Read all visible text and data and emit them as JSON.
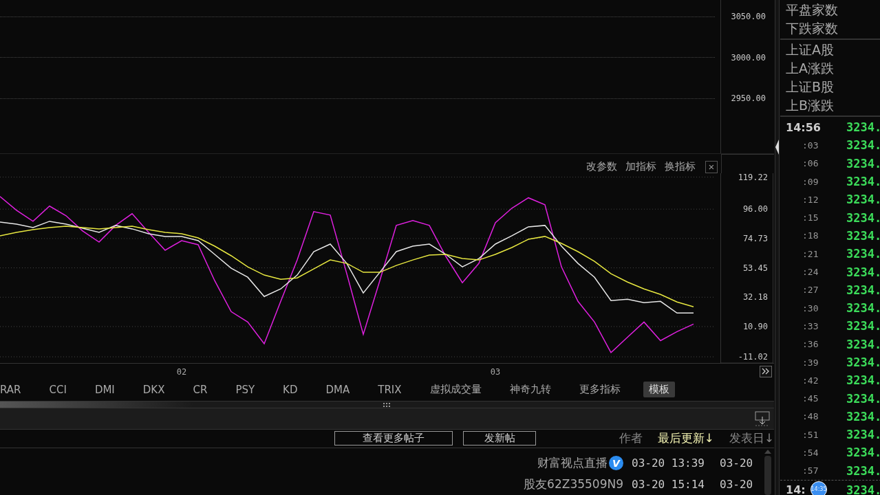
{
  "price_axis": {
    "labels": [
      "3050.00",
      "3000.00",
      "2950.00"
    ]
  },
  "indicator": {
    "buttons": [
      "改参数",
      "加指标",
      "换指标"
    ],
    "close": "×",
    "chart_data": {
      "type": "line",
      "categories": [
        null,
        null,
        null,
        null,
        null,
        null,
        null,
        null,
        null,
        null,
        null,
        "02",
        null,
        null,
        null,
        null,
        null,
        null,
        null,
        null,
        null,
        null,
        null,
        null,
        null,
        null,
        null,
        null,
        null,
        null,
        "03",
        null,
        null,
        null,
        null,
        null,
        null,
        null,
        null,
        null,
        null,
        null,
        null
      ],
      "grid": true,
      "ylim": [
        -11.02,
        119.22
      ],
      "yticks": [
        {
          "value": 119.22,
          "label": "119.22"
        },
        {
          "value": 96.0,
          "label": "96.00"
        },
        {
          "value": 74.73,
          "label": "74.73"
        },
        {
          "value": 53.45,
          "label": "53.45"
        },
        {
          "value": 32.18,
          "label": "32.18"
        },
        {
          "value": 10.9,
          "label": "10.90"
        },
        {
          "value": -11.02,
          "label": "-11.02"
        }
      ],
      "series": [
        {
          "color": "#e020e0",
          "values": [
            105.2,
            95.2,
            87.2,
            98.2,
            91.2,
            80.2,
            72.2,
            84.2,
            92.7,
            79.2,
            66.2,
            73.2,
            70.2,
            44.2,
            21.7,
            14.2,
            -1.5,
            29.2,
            59.2,
            94.2,
            91.7,
            49.2,
            5.2,
            44.2,
            84.2,
            87.7,
            84.2,
            61.7,
            42.7,
            56.7,
            86.2,
            96.7,
            104.2,
            99.2,
            54.2,
            29.2,
            14.2,
            -8.0,
            3.2,
            14.2,
            0.7,
            7.2,
            12.7
          ]
        },
        {
          "color": "#e8e8e8",
          "values": [
            86.7,
            85.2,
            82.7,
            87.2,
            85.2,
            82.2,
            79.2,
            84.2,
            81.7,
            78.2,
            76.2,
            76.2,
            73.2,
            63.2,
            53.2,
            46.7,
            32.7,
            38.2,
            48.2,
            65.2,
            70.7,
            56.7,
            35.2,
            50.2,
            65.2,
            69.2,
            70.7,
            63.2,
            54.2,
            60.2,
            70.7,
            76.7,
            83.2,
            84.2,
            69.2,
            56.7,
            46.7,
            29.7,
            30.7,
            28.2,
            29.2,
            20.7,
            20.7
          ]
        },
        {
          "color": "#e8e840",
          "values": [
            76.7,
            79.2,
            81.2,
            82.7,
            83.7,
            82.7,
            81.7,
            82.7,
            83.7,
            81.2,
            79.2,
            78.2,
            75.2,
            69.2,
            62.2,
            54.2,
            48.2,
            45.2,
            46.2,
            52.7,
            59.2,
            56.7,
            50.2,
            50.2,
            55.2,
            59.2,
            62.7,
            63.2,
            60.2,
            59.2,
            63.2,
            68.2,
            74.2,
            76.2,
            71.2,
            65.2,
            58.2,
            49.2,
            43.2,
            38.2,
            34.2,
            28.7,
            25.2
          ]
        }
      ]
    }
  },
  "indicator_tabs": [
    {
      "label": "RAR",
      "selected": false
    },
    {
      "label": "CCI",
      "selected": false
    },
    {
      "label": "DMI",
      "selected": false
    },
    {
      "label": "DKX",
      "selected": false
    },
    {
      "label": "CR",
      "selected": false
    },
    {
      "label": "PSY",
      "selected": false
    },
    {
      "label": "KD",
      "selected": false
    },
    {
      "label": "DMA",
      "selected": false
    },
    {
      "label": "TRIX",
      "selected": false
    },
    {
      "label": "虚拟成交量",
      "selected": false
    },
    {
      "label": "神奇九转",
      "selected": false
    },
    {
      "label": "更多指标",
      "selected": false
    },
    {
      "label": "模板",
      "selected": true
    }
  ],
  "forum": {
    "buttons": [
      "查看更多帖子",
      "发新帖"
    ],
    "columns": [
      {
        "label": "作者",
        "selected": false
      },
      {
        "label": "最后更新↓",
        "selected": true
      },
      {
        "label": "发表日↓",
        "selected": false
      }
    ],
    "rows": [
      {
        "author": "财富视点直播",
        "verified": true,
        "badge": "V",
        "updated": "03-20 13:39",
        "posted": "03-20"
      },
      {
        "author": "股友62Z35509N9",
        "verified": false,
        "updated": "03-20 15:14",
        "posted": "03-20"
      }
    ]
  },
  "side_panel": {
    "market_stats": [
      "平盘家数",
      "下跌家数"
    ],
    "index_stats": [
      "上证A股",
      "上A涨跌",
      "上证B股",
      "上B涨跌"
    ],
    "ticks": [
      {
        "time": "14:56",
        "price": "3234.",
        "kind": "minute",
        "marked": false
      },
      {
        "time": ":03",
        "price": "3234.",
        "kind": "second",
        "marked": false
      },
      {
        "time": ":06",
        "price": "3234.",
        "kind": "second",
        "marked": false
      },
      {
        "time": ":09",
        "price": "3234.",
        "kind": "second",
        "marked": false
      },
      {
        "time": ":12",
        "price": "3234.",
        "kind": "second",
        "marked": false
      },
      {
        "time": ":15",
        "price": "3234.",
        "kind": "second",
        "marked": false
      },
      {
        "time": ":18",
        "price": "3234.",
        "kind": "second",
        "marked": false
      },
      {
        "time": ":21",
        "price": "3234.",
        "kind": "second",
        "marked": false
      },
      {
        "time": ":24",
        "price": "3234.",
        "kind": "second",
        "marked": false
      },
      {
        "time": ":27",
        "price": "3234.",
        "kind": "second",
        "marked": false
      },
      {
        "time": ":30",
        "price": "3234.",
        "kind": "second",
        "marked": false
      },
      {
        "time": ":33",
        "price": "3234.",
        "kind": "second",
        "marked": false
      },
      {
        "time": ":36",
        "price": "3234.",
        "kind": "second",
        "marked": false
      },
      {
        "time": ":39",
        "price": "3234.",
        "kind": "second",
        "marked": false
      },
      {
        "time": ":42",
        "price": "3234.",
        "kind": "second",
        "marked": false
      },
      {
        "time": ":45",
        "price": "3234.",
        "kind": "second",
        "marked": false
      },
      {
        "time": ":48",
        "price": "3234.",
        "kind": "second",
        "marked": false
      },
      {
        "time": ":51",
        "price": "3234.",
        "kind": "second",
        "marked": false
      },
      {
        "time": ":54",
        "price": "3234.",
        "kind": "second",
        "marked": false
      },
      {
        "time": ":57",
        "price": "3234.",
        "kind": "second",
        "marked": false
      },
      {
        "time": "14:",
        "price": "3234.",
        "kind": "minute",
        "marked": true
      }
    ],
    "time_bubble": "14:35"
  }
}
